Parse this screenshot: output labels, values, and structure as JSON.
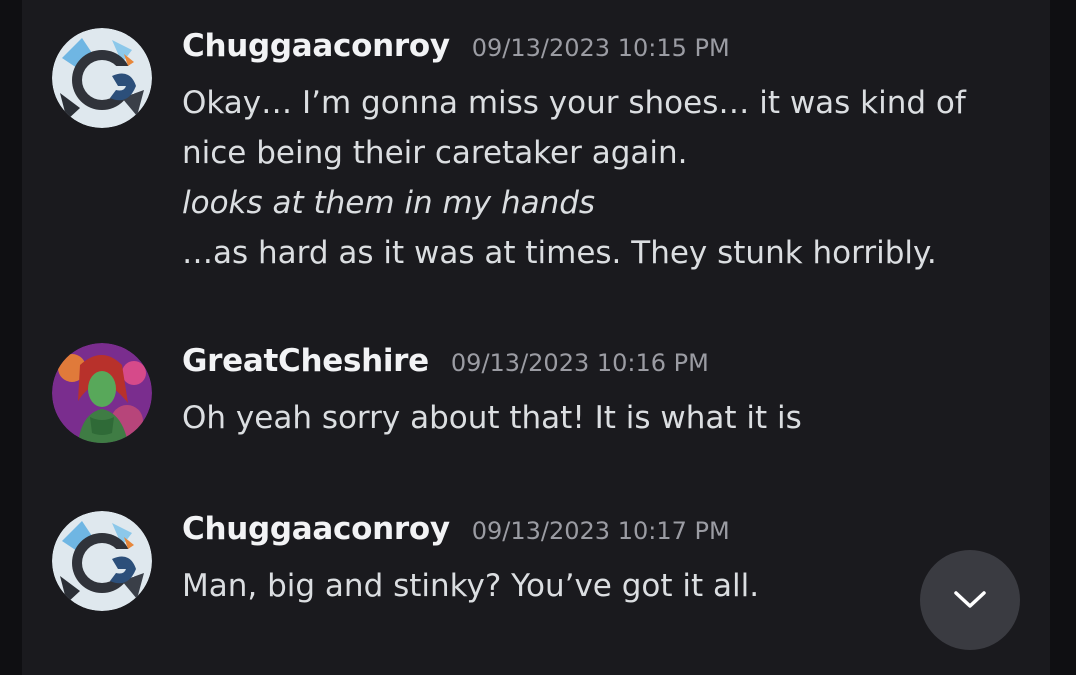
{
  "messages": [
    {
      "username": "Chuggaaconroy",
      "timestamp": "09/13/2023 10:15 PM",
      "lines": [
        {
          "text": "Okay… I’m gonna miss your shoes… it was kind of",
          "italic": false
        },
        {
          "text": "nice being their caretaker again.",
          "italic": false
        },
        {
          "text": "looks at them in my hands",
          "italic": true
        },
        {
          "text": "…as hard as it was at times. They stunk horribly.",
          "italic": false
        }
      ],
      "avatar_icon": "chuggaaconroy-avatar"
    },
    {
      "username": "GreatCheshire",
      "timestamp": "09/13/2023 10:16 PM",
      "lines": [
        {
          "text": "Oh yeah sorry about that! It is what it is",
          "italic": false
        }
      ],
      "avatar_icon": "greatcheshire-avatar"
    },
    {
      "username": "Chuggaaconroy",
      "timestamp": "09/13/2023 10:17 PM",
      "lines": [
        {
          "text": "Man, big and stinky? You’ve got it all.",
          "italic": false
        }
      ],
      "avatar_icon": "chuggaaconroy-avatar"
    }
  ],
  "scroll_button": {
    "icon": "chevron-down-icon"
  },
  "colors": {
    "background": "#1a1a1e",
    "username": "#f2f3f5",
    "message_text": "#dbdee1",
    "timestamp": "#9b9ca3",
    "scroll_button": "#3a3b41"
  }
}
